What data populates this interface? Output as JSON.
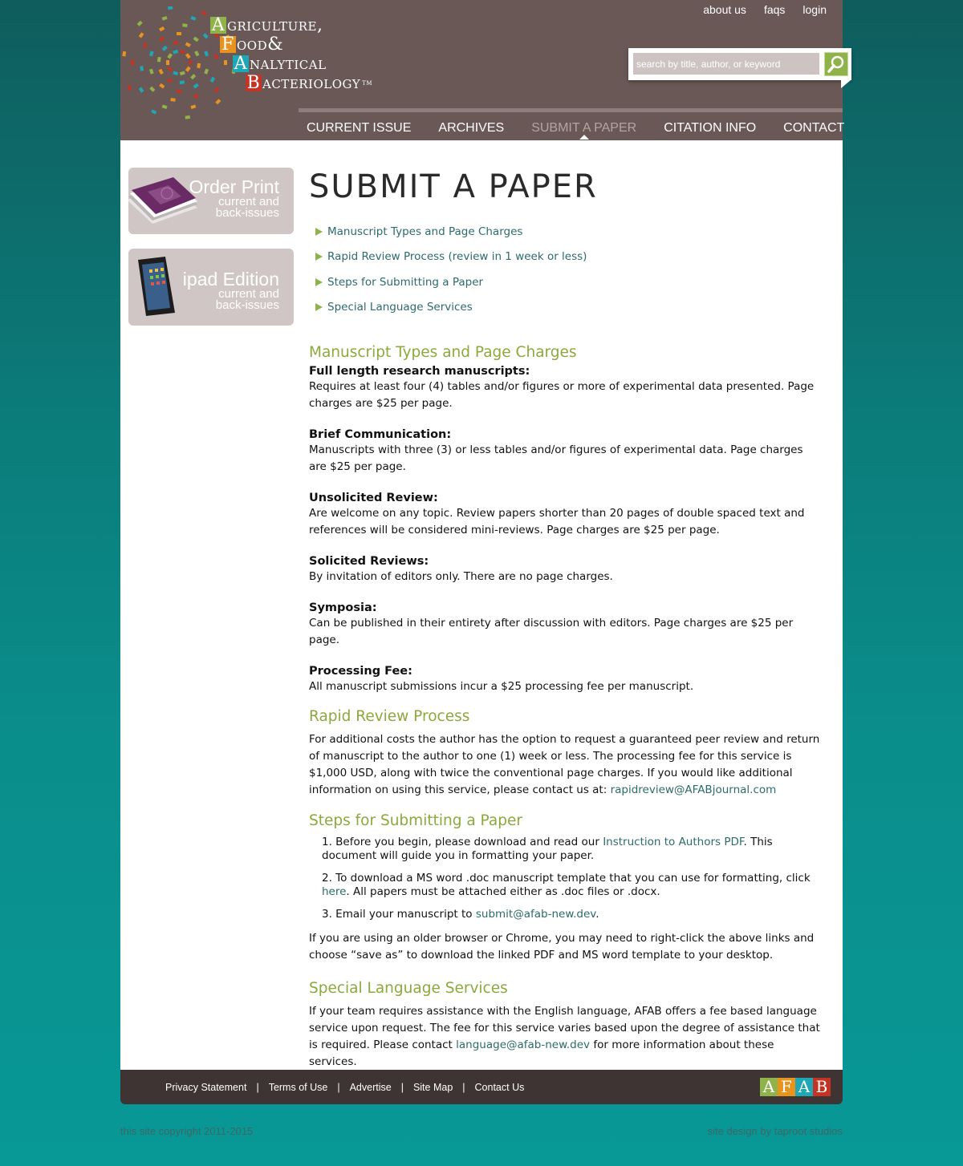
{
  "logo": {
    "lines": [
      {
        "cap": "A",
        "rest": "griculture,",
        "cap_color": "#8fb34a"
      },
      {
        "cap": "F",
        "rest": "ood&",
        "cap_color": "#e8931e"
      },
      {
        "cap": "A",
        "rest": "nalytical",
        "cap_color": "#20a7b5"
      },
      {
        "cap": "B",
        "rest": "acteriology",
        "cap_color": "#c43424"
      }
    ],
    "tm": "TM"
  },
  "topnav": [
    "about us",
    "faqs",
    "login"
  ],
  "search": {
    "placeholder": "search by title, author, or keyword"
  },
  "mainnav": [
    {
      "label": "CURRENT ISSUE",
      "active": false
    },
    {
      "label": "ARCHIVES",
      "active": false
    },
    {
      "label": "SUBMIT A PAPER",
      "active": true
    },
    {
      "label": "CITATION INFO",
      "active": false
    },
    {
      "label": "CONTACT",
      "active": false
    }
  ],
  "sidebar": {
    "print": {
      "title": "Order Print",
      "sub1": "current and",
      "sub2": "back-issues"
    },
    "ipad": {
      "title": "ipad Edition",
      "sub1": "current and",
      "sub2": "back-issues"
    }
  },
  "page_title": "SUBMIT A PAPER",
  "toc": [
    "Manuscript Types and Page Charges",
    "Rapid Review Process (review in 1 week or less)",
    "Steps for Submitting a Paper",
    "Special Language Services"
  ],
  "manuscript": {
    "heading": "Manuscript Types and Page Charges",
    "entries": [
      {
        "title": "Full length research manuscripts:",
        "body": "Requires at least four (4) tables and/or figures or more of experimental data presented. Page charges are $25 per page."
      },
      {
        "title": "Brief Communication:",
        "body": "Manuscripts with three (3) or less tables and/or figures of experimental data. Page charges are $25 per page."
      },
      {
        "title": "Unsolicited Review:",
        "body": "Are welcome on any topic. Review papers shorter than 20 pages of double spaced text and references will be considered mini-reviews. Page charges are $25 per page."
      },
      {
        "title": "Solicited Reviews:",
        "body": "By invitation of editors only. There are no page charges."
      },
      {
        "title": "Symposia:",
        "body": "Can be published in their entirety after discussion with editors. Page charges are $25 per page."
      },
      {
        "title": "Processing Fee:",
        "body": "All manuscript submissions incur a $25 processing fee per manuscript."
      }
    ]
  },
  "rapid": {
    "heading": "Rapid Review Process",
    "body": "For additional costs the author has the option to request a guaranteed peer review and return of manuscript to the author to one (1) week or less. The processing fee for this service is $1,000 USD, along with twice the conventional page charges. If you would like additional information on using this service, please contact us at:",
    "email": "rapidreview@AFABjournal.com"
  },
  "steps": {
    "heading": "Steps for Submitting a Paper",
    "s1_pre": "1. Before you begin, please download and read our",
    "s1_link": "Instruction to Authors PDF",
    "s1_post": ". This document will guide you in formatting your paper.",
    "s2_pre": "2. To download a MS word .doc manuscript template that you can use for formatting, click",
    "s2_link": "here",
    "s2_post": ". All papers must be attached either as .doc files or .docx.",
    "s3_pre": "3. Email your manuscript to",
    "s3_link": "submit@afab-new.dev",
    "s3_post": ".",
    "note": "If you are using an older browser or Chrome, you may need to right-click the above links and choose “save as” to download the linked PDF and MS word template to your desktop."
  },
  "language": {
    "heading": "Special Language Services",
    "body_pre": "If your team requires assistance with the English language, AFAB offers a fee based language service upon request. The fee for this service varies based upon the degree of assistance that is required. Please contact",
    "email": "language@afab-new.dev",
    "body_post": "for more information about these services."
  },
  "footer": {
    "links": [
      "Privacy Statement",
      "Terms of Use",
      "Advertise",
      "Site Map",
      "Contact Us"
    ],
    "logo_letters": [
      {
        "char": "A",
        "color": "#8fb34a"
      },
      {
        "char": "F",
        "color": "#e8931e"
      },
      {
        "char": "A",
        "color": "#20a7b5"
      },
      {
        "char": "B",
        "color": "#c43424"
      }
    ],
    "copyright": "this site copyright 2011-2015",
    "credit": "site design by taproot studios"
  },
  "colors": {
    "header_bg": "#6a5857",
    "accent_green": "#8ca93b",
    "link_teal": "#2d6b6b",
    "footer_bg": "#3e3433"
  }
}
